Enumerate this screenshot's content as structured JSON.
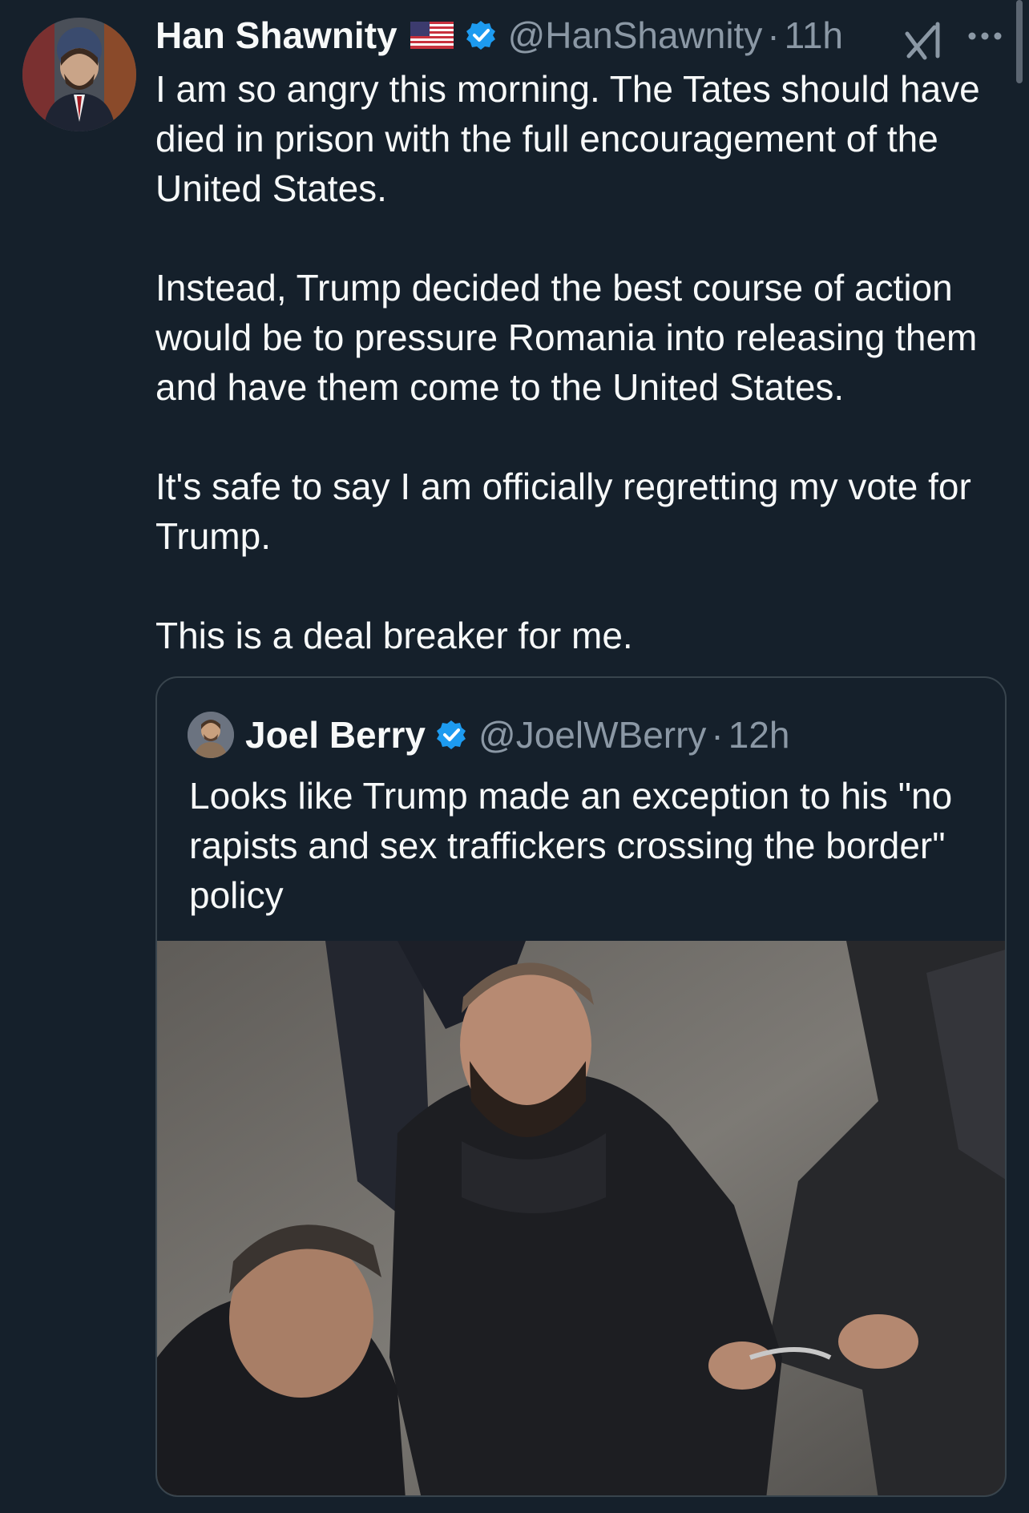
{
  "tweet": {
    "author_name": "Han Shawnity",
    "author_handle": "@HanShawnity",
    "separator": "·",
    "time": "11h",
    "flag_icon": "us-flag-icon",
    "verified_icon": "verified-badge-icon",
    "paragraphs": [
      "I am so angry this morning. The Tates should have died in prison with the full encouragement of the United States.",
      "Instead, Trump decided the best course of action would be to pressure Romania into releasing them and have them come to the United States.",
      "It's safe to say I am officially regretting my vote for Trump.",
      "This is a deal breaker for me."
    ]
  },
  "quote": {
    "author_name": "Joel Berry",
    "author_handle": "@JoelWBerry",
    "separator": "·",
    "time": "12h",
    "text": "Looks like Trump made an exception to his \"no rapists and sex traffickers crossing the border\" policy",
    "media_icon": "photo"
  },
  "icons": {
    "grok": "grok-icon",
    "more": "more-options-icon"
  },
  "colors": {
    "background": "#15202b",
    "text_primary": "#f7f9f9",
    "text_secondary": "#8b98a5",
    "verified": "#1d9bf0",
    "border": "#38444d"
  }
}
